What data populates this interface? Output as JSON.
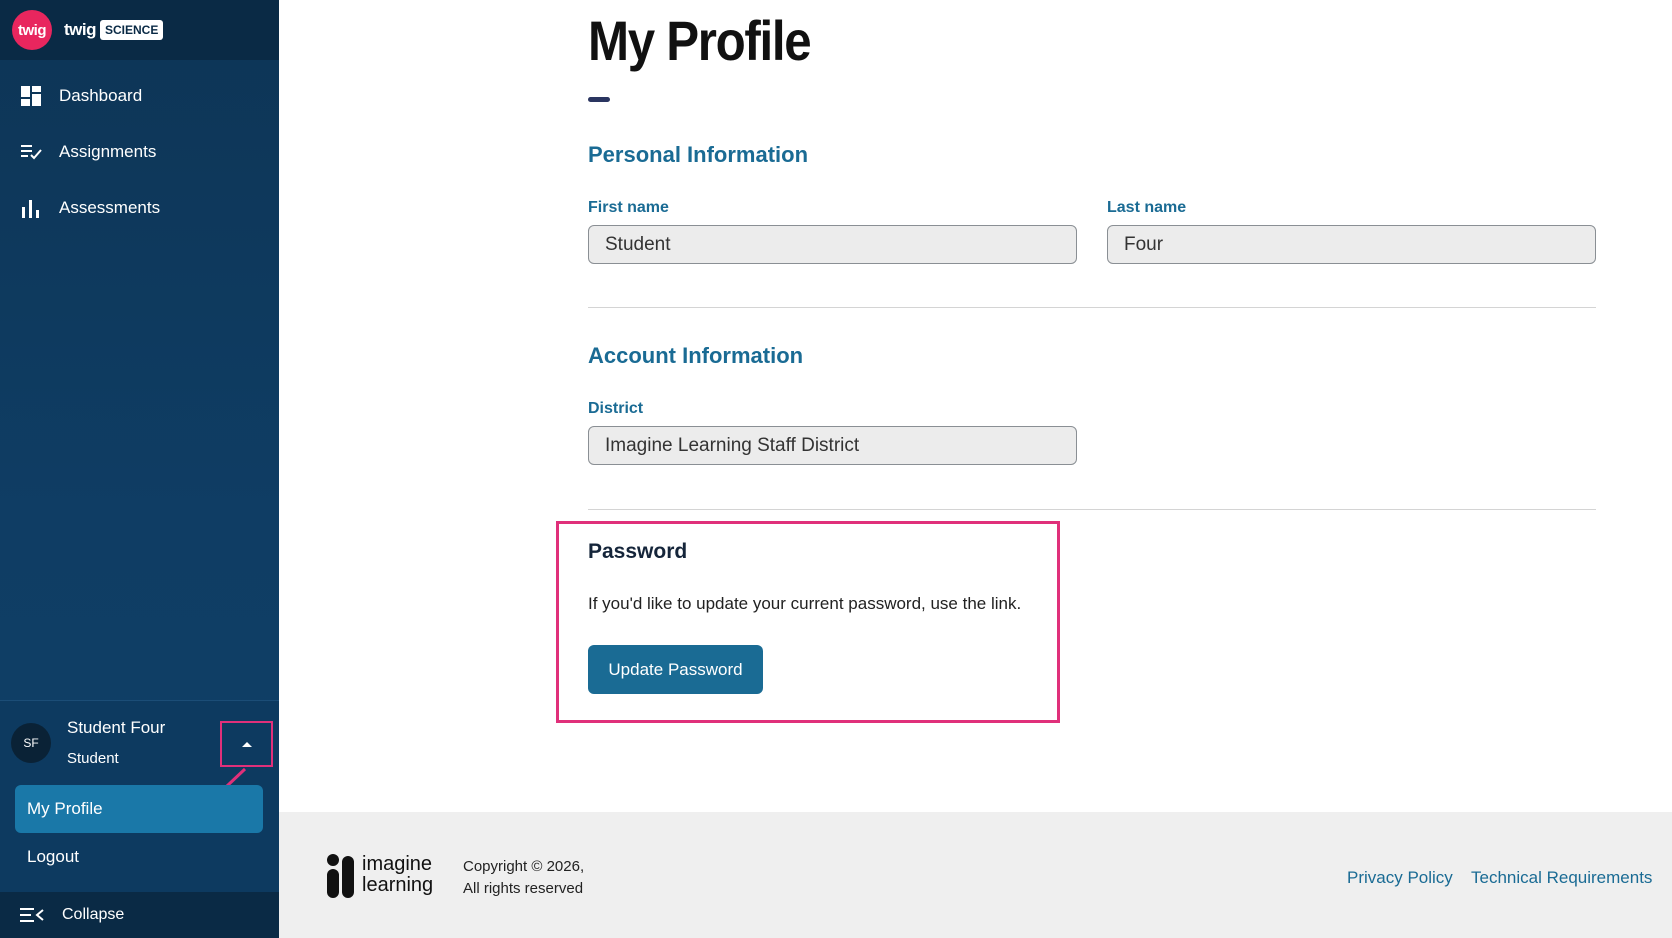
{
  "brand": {
    "mark": "twig",
    "word": "twig",
    "pill": "SCIENCE"
  },
  "sidebar": {
    "items": [
      {
        "label": "Dashboard",
        "icon": "dashboard-icon"
      },
      {
        "label": "Assignments",
        "icon": "assignments-icon"
      },
      {
        "label": "Assessments",
        "icon": "assessments-icon"
      }
    ],
    "user": {
      "initials": "SF",
      "name": "Student Four",
      "role": "Student"
    },
    "menu": {
      "profile": "My Profile",
      "logout": "Logout"
    },
    "collapse_label": "Collapse"
  },
  "page": {
    "title": "My Profile",
    "personal": {
      "heading": "Personal Information",
      "first_name_label": "First name",
      "first_name_value": "Student",
      "last_name_label": "Last name",
      "last_name_value": "Four"
    },
    "account": {
      "heading": "Account Information",
      "district_label": "District",
      "district_value": "Imagine Learning Staff District"
    },
    "password": {
      "heading": "Password",
      "text": "If you'd like to update your current password, use the link.",
      "button": "Update Password"
    }
  },
  "footer": {
    "logo_line1": "imagine",
    "logo_line2": "learning",
    "copyright_line1": "Copyright © 2026,",
    "copyright_line2": "All rights reserved",
    "privacy": "Privacy Policy",
    "tech": "Technical Requirements"
  },
  "colors": {
    "sidebar": "#0f3d64",
    "accent": "#1a6b94",
    "highlight": "#e0307a",
    "brand": "#e8265e"
  }
}
